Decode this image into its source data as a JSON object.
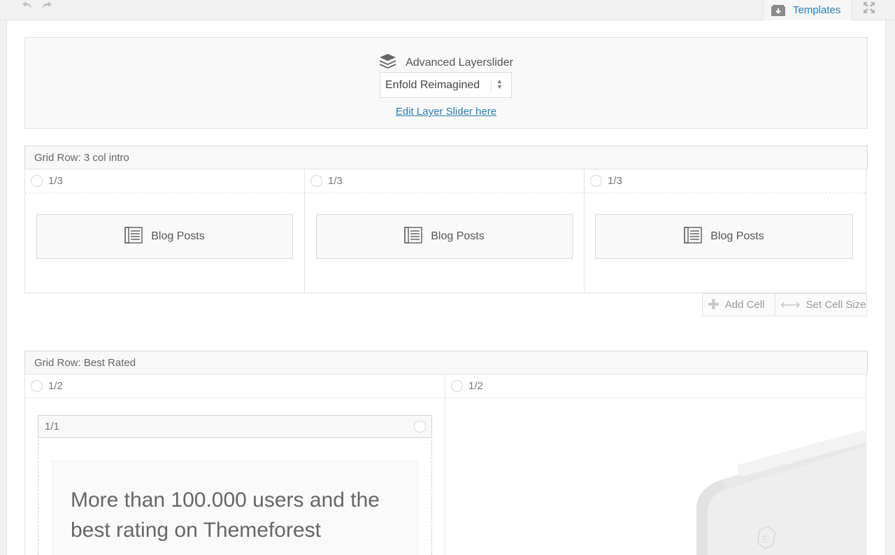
{
  "toolbar": {
    "undo_icon": "undo-icon",
    "redo_icon": "redo-icon",
    "templates_label": "Templates",
    "fullscreen_icon": "fullscreen-icon"
  },
  "layerslider": {
    "title": "Advanced Layerslider",
    "selected": "Enfold Reimagined",
    "edit_link": "Edit Layer Slider here"
  },
  "grid_rows": [
    {
      "title": "Grid Row: 3 col intro",
      "cells": [
        {
          "size": "1/3",
          "element": "Blog Posts"
        },
        {
          "size": "1/3",
          "element": "Blog Posts"
        },
        {
          "size": "1/3",
          "element": "Blog Posts"
        }
      ]
    },
    {
      "title": "Grid Row: Best Rated",
      "cells": [
        {
          "size": "1/2"
        },
        {
          "size": "1/2"
        }
      ]
    }
  ],
  "row_actions": {
    "add_cell": "Add Cell",
    "set_cell_size": "Set Cell Size"
  },
  "inner_column": {
    "size": "1/1",
    "text": "More than 100.000 users and the best rating on Themeforest"
  },
  "colors": {
    "link": "#2d7fb0",
    "canvas": "#ffffff",
    "chrome": "#f1f1f1"
  }
}
